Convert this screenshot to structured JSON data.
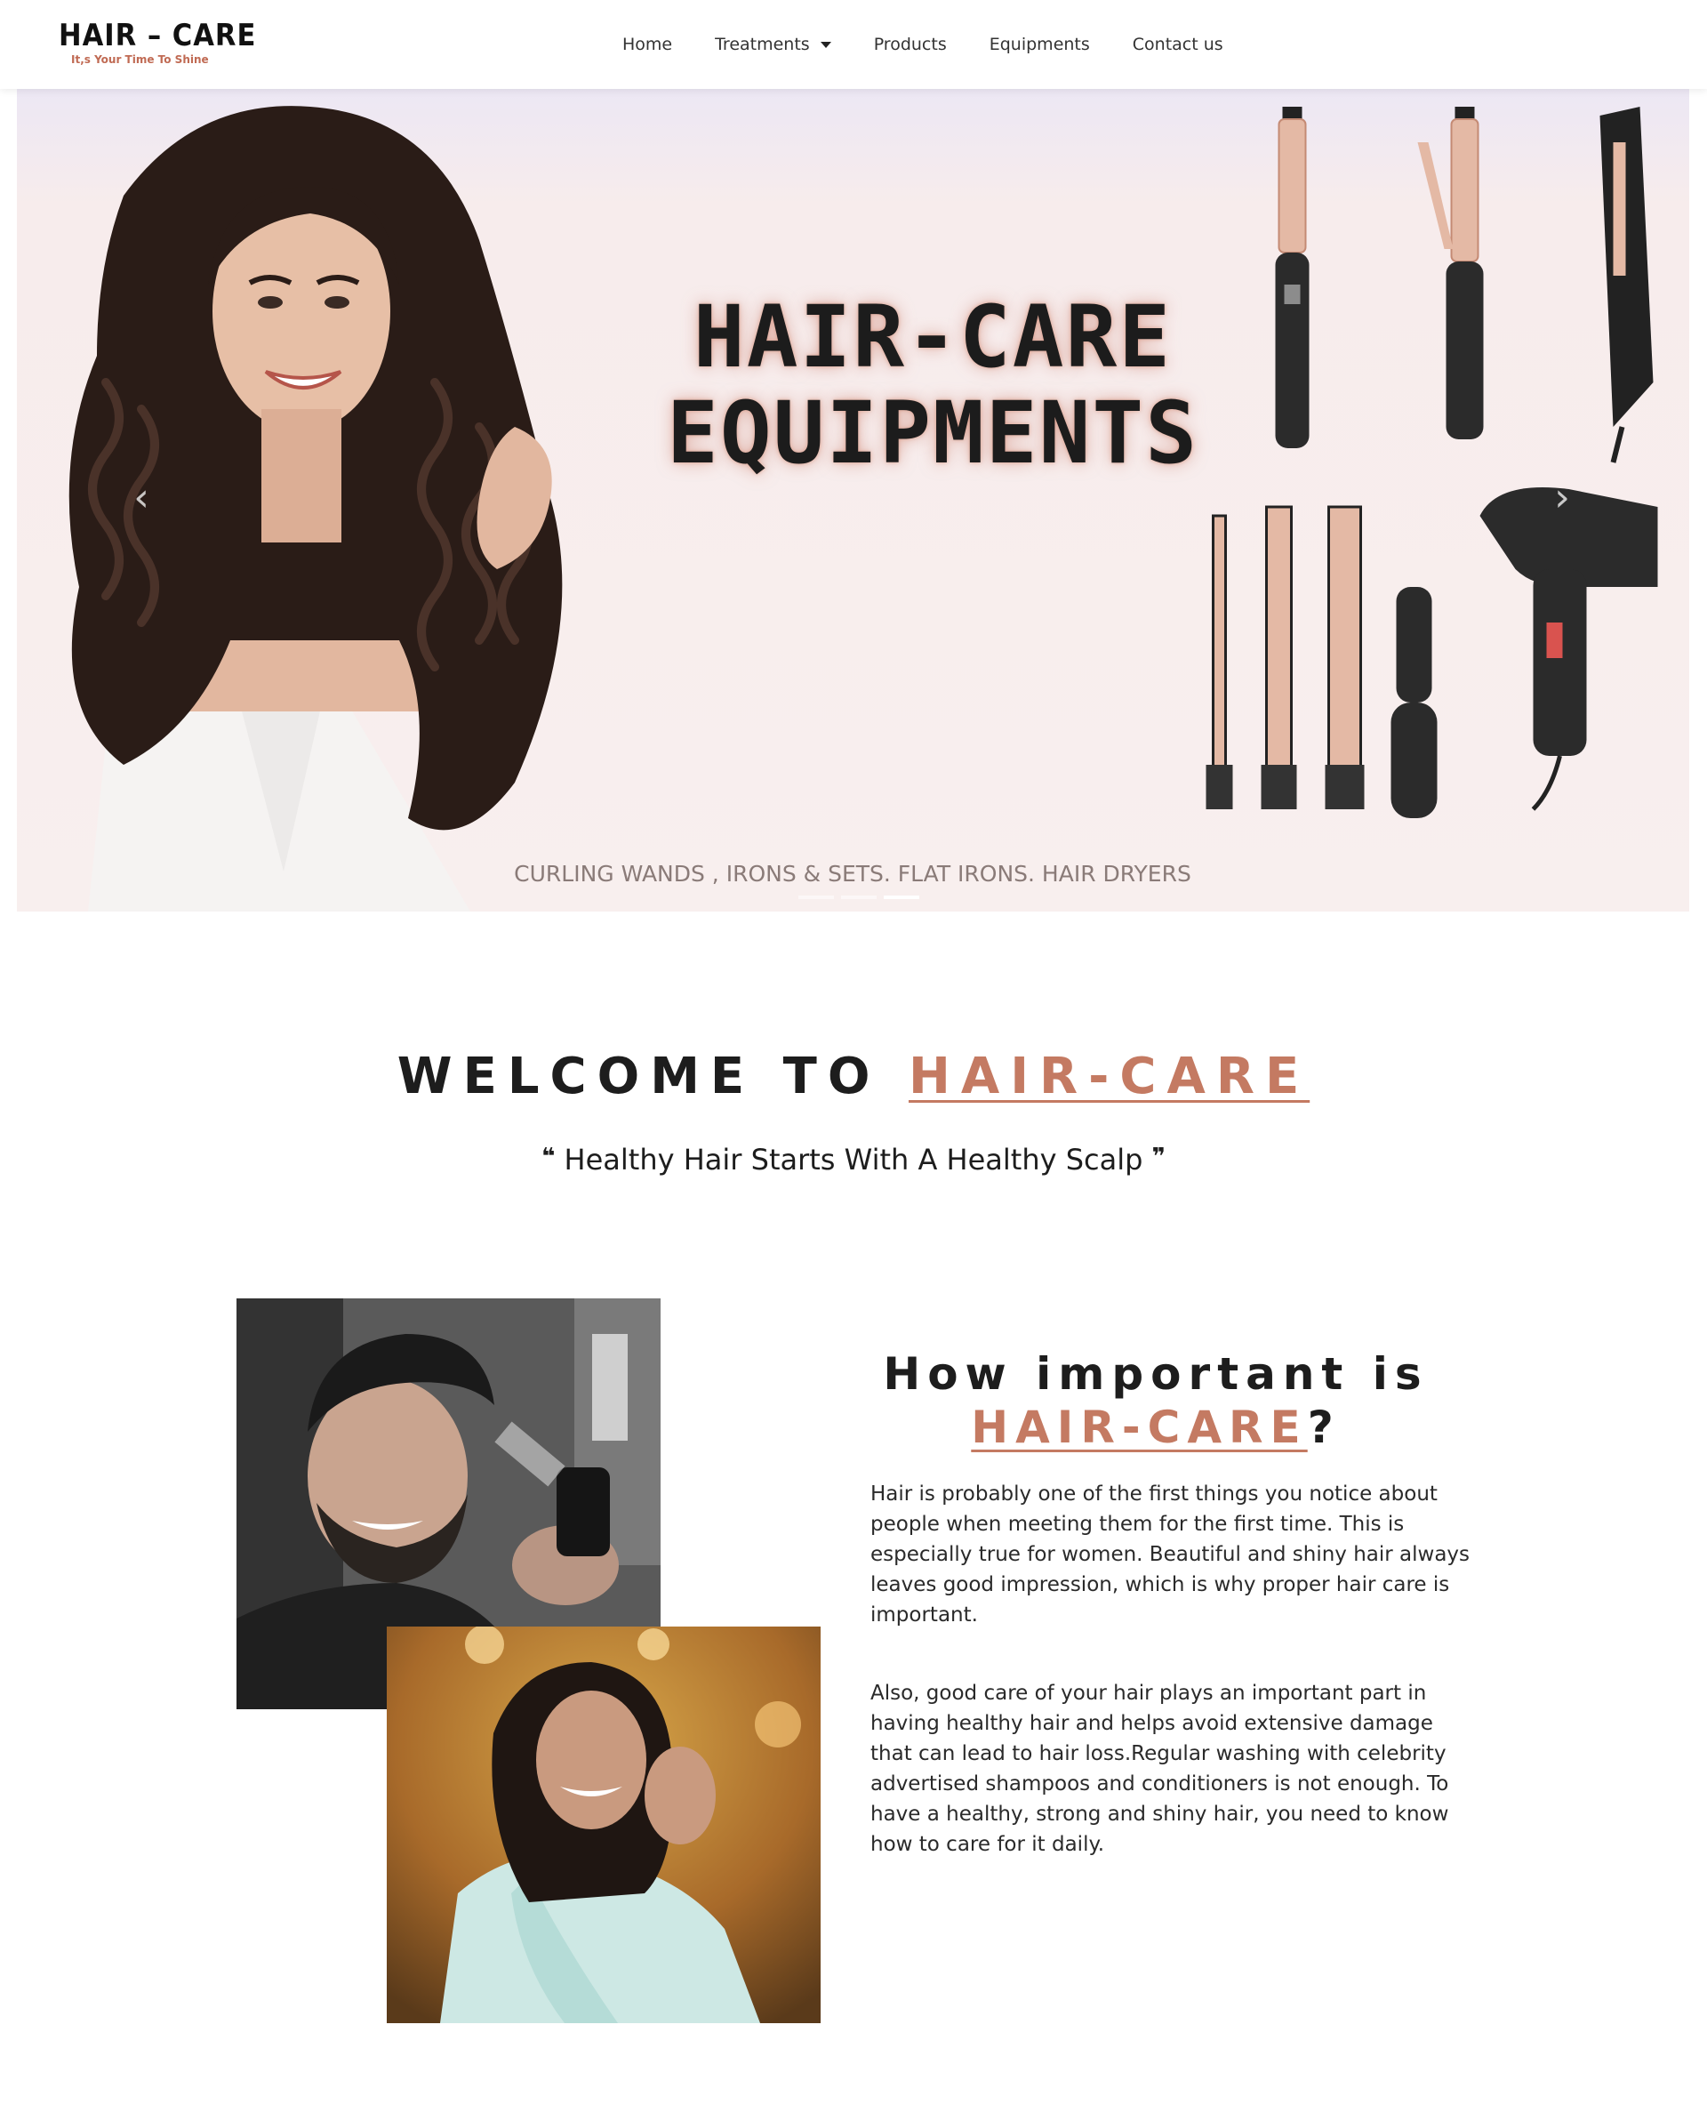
{
  "navbar": {
    "logo_main": "HAIR – CARE",
    "logo_tagline": "It,s Your Time To Shine",
    "links": {
      "home": "Home",
      "treatments": "Treatments",
      "products": "Products",
      "equipments": "Equipments",
      "contact": "Contact us"
    }
  },
  "hero": {
    "title_line1": "HAIR-CARE",
    "title_line2": "EQUIPMENTS",
    "subtitle": "CURLING WANDS , IRONS & SETS. FLAT IRONS. HAIR DRYERS",
    "prev_icon": "‹",
    "next_icon": "›",
    "slide_count": 3,
    "active_slide": 3
  },
  "welcome": {
    "prefix": "WELCOME TO ",
    "brand": "HAIR-CARE",
    "quote_open": "❝",
    "quote": " Healthy Hair Starts With A Healthy Scalp ",
    "quote_close": "❞"
  },
  "about": {
    "title_prefix": "How important is",
    "title_brand": "HAIR-CARE",
    "title_suffix": "?",
    "paragraph1": "Hair is probably one of the first things you notice about people when meeting them for the first time. This is especially true for women. Beautiful and shiny hair always leaves good impression, which is why proper hair care is important.",
    "paragraph2": "Also, good care of your hair plays an important part in having healthy hair and helps avoid extensive damage that can lead to hair loss.Regular washing with celebrity advertised shampoos and conditioners is not enough. To have a healthy, strong and shiny hair, you need to know how to care for it daily."
  },
  "colors": {
    "accent": "#c47a62",
    "text": "#1d1d1d",
    "hero_bg": "#f8efee"
  }
}
